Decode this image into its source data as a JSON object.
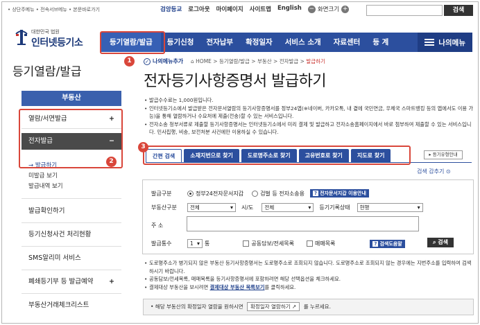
{
  "topbar": {
    "skip_links": "• 상단주메뉴  • 전속서브메뉴  • 본문바로가기",
    "util": [
      "검앙등교",
      "로그아웃",
      "마이페이지",
      "사이트맵",
      "English"
    ],
    "zoom_label": "화면크기",
    "zoom_minus": "−",
    "zoom_plus": "+",
    "search_button": "검색"
  },
  "logo": {
    "small": "대한민국 법원",
    "big": "인터넷등기소"
  },
  "nav": {
    "items": [
      "등기열람/발급",
      "등기신청",
      "전자납부",
      "확정일자",
      "서비스 소개",
      "자료센터",
      "등 계"
    ],
    "mymenu": "나의메뉴"
  },
  "badges": [
    "1",
    "2",
    "3"
  ],
  "sidebar": {
    "title": "등기열람/발급",
    "head": "부동산",
    "items": [
      {
        "label": "열람/서면발급",
        "sign": "+"
      },
      {
        "label": "전자발급",
        "sign": "−"
      }
    ],
    "subitems": [
      "→ 발급하기",
      "미발급 보기",
      "발급내역 보기"
    ],
    "more": [
      "발급확인하기",
      "등기신청사건 처리현황",
      "SMS알리미 서비스",
      "폐쇄등기부 등 발급예약",
      "부동산거래체크리스트"
    ],
    "more_signs": [
      "+"
    ]
  },
  "breadcrumb": {
    "mymenu_add": "나의메뉴추가",
    "path": "HOME > 등기열람/발급 > 부동산 > 전자발급 > ",
    "current": "발급하기"
  },
  "page_title": "전자등기사항증명서 발급하기",
  "notes": [
    "발급수수료는 1,000원입니다.",
    "인터넷등기소에서 발급받은 전자문서열람의 등기사항증명서를 정부24앱(※네이버, 카카오톡, 내 곁에 국민연금, 우체국 스마트뱅킹 등의 앱에서도 이용 가능)을 통해 열람하거나 수요처에 제출(전송)할 수 있는 서비스입니다.",
    "전자소송 청부서류로 제출할 등기사항증명서는 인터넷등기소에서 미리 결제 및 발급하고 전자소송홈페이지에서 바로 첨부하여 제출할 수 있는 서비스입니다. 민사집행, 비송, 보전처분 사건에만 이용하실 수 있습니다."
  ],
  "tabs": [
    "간편 검색",
    "소재지번으로 찾기",
    "도로명주소로 찾기",
    "고유번호로 찾기",
    "지도로 찾기"
  ],
  "guide_button": "▸ 등기유형안내",
  "filter_label": "검색 감추기 ⊙",
  "form": {
    "type_label": "발급구분",
    "radio1": "정부24전자문서지갑",
    "radio2": "검벌 등 전자소송용",
    "wallet_guide": "전자문서지갑 이용안내",
    "kind_label": "부동산구분",
    "kind_value": "전체",
    "sido_label": "시/도",
    "sido_value": "전체",
    "status_label": "등기기록상태",
    "status_value": "현행",
    "addr_label": "주 소",
    "count_label": "발급통수",
    "count_value": "1",
    "count_unit": "통",
    "chk1": "공동담보/전세목록",
    "chk2": "매매목록",
    "help": "검색도움말",
    "search": "검색"
  },
  "notes2": [
    "도로명주소가 병기되지 않은 부동산 등기사항증명서는 도로명주소로 조회되지 않습니다. 도로명주소로 조회되지 않는 경우에는 지번주소를 입력하여 검색하시기 바랍니다.",
    "공동담보/전세목록, 매매목록을 등기사항증명서에 포함하려면 해당 선택옵션을 체크하세요."
  ],
  "notes2_last": {
    "pre": "결제대상 부동산을 보시려면 ",
    "link": "결제대상 부동산 목록보기",
    "post": "를 클릭하세요."
  },
  "infobox": {
    "pre": "• 해당 부동산의 확정일자 열람을 원하시면 ",
    "button": "확정일자 열람하기",
    "post": " 를 누르세요."
  },
  "colors": {
    "nav": "#2c4f9e",
    "accent_red": "#d9463a",
    "dark": "#333333"
  }
}
